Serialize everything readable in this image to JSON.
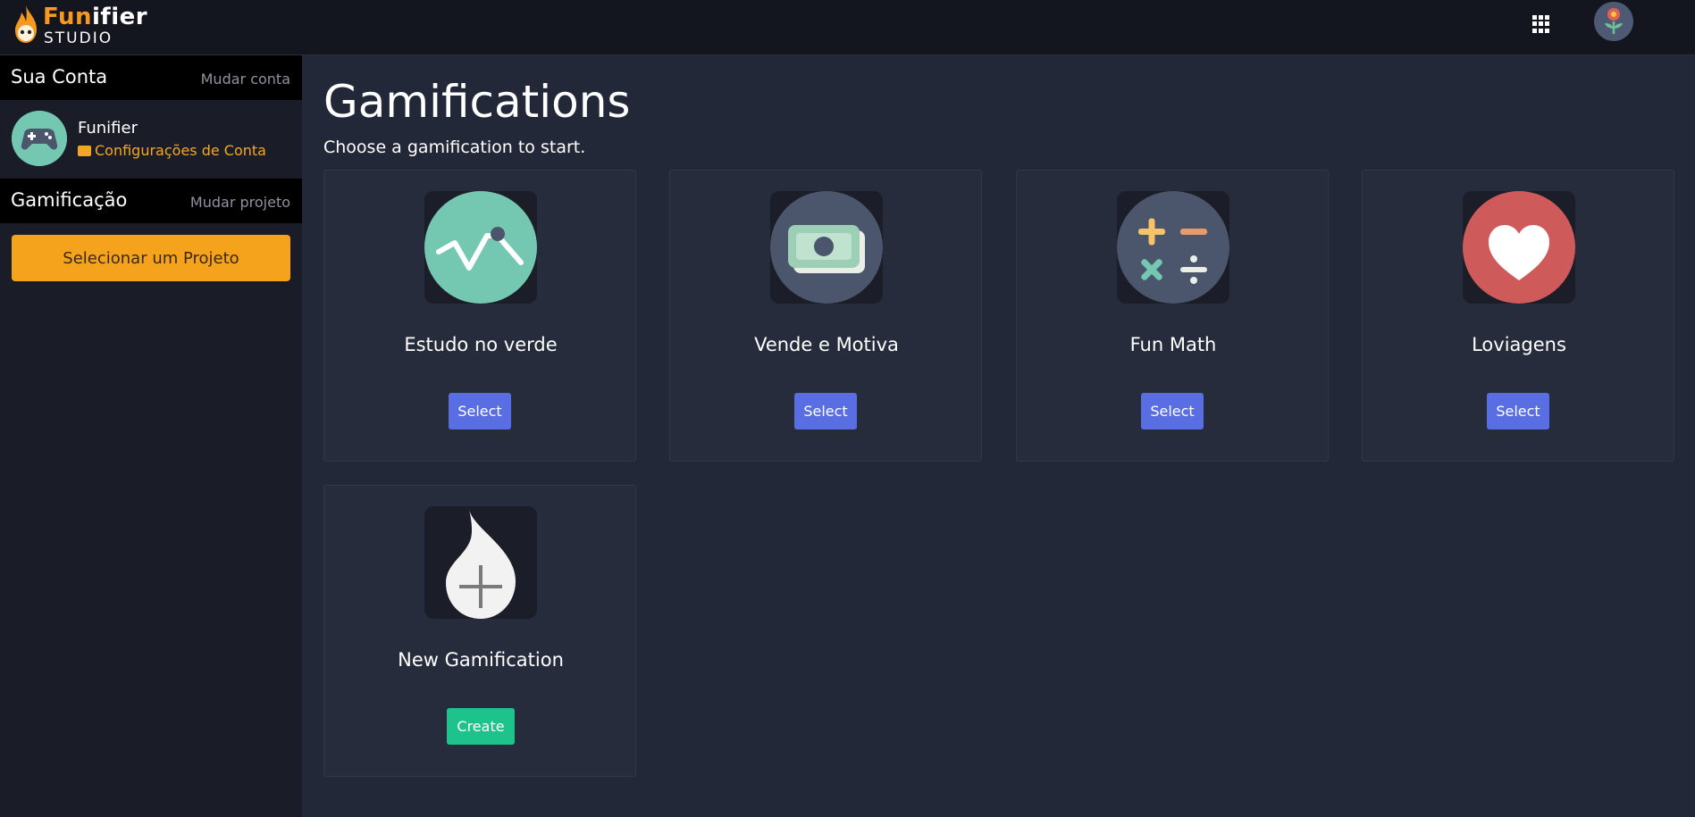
{
  "header": {
    "logo": {
      "brand_part1": "Fun",
      "brand_part2": "ifier",
      "sub": "STUDIO"
    },
    "apps_icon": "grid-icon",
    "user_avatar_icon": "flower-avatar-icon"
  },
  "sidebar": {
    "account_section": {
      "title": "Sua Conta",
      "action": "Mudar conta"
    },
    "account": {
      "name": "Funifier",
      "settings_link": "Configurações de Conta",
      "avatar_icon": "gamepad-icon"
    },
    "project_section": {
      "title": "Gamificação",
      "action": "Mudar projeto"
    },
    "select_project_button": "Selecionar um Projeto"
  },
  "main": {
    "title": "Gamifications",
    "subtitle": "Choose a gamification to start.",
    "cards": [
      {
        "name": "Estudo no verde",
        "button": "Select",
        "icon": "line-chart-icon"
      },
      {
        "name": "Vende e Motiva",
        "button": "Select",
        "icon": "money-icon"
      },
      {
        "name": "Fun Math",
        "button": "Select",
        "icon": "math-operators-icon"
      },
      {
        "name": "Loviagens",
        "button": "Select",
        "icon": "heart-icon"
      },
      {
        "name": "New Gamification",
        "button": "Create",
        "icon": "flame-plus-icon"
      }
    ]
  },
  "colors": {
    "accent_orange": "#f5a21c",
    "select_blue": "#5a6ee4",
    "create_green": "#1ec38c",
    "background": "#232838"
  }
}
